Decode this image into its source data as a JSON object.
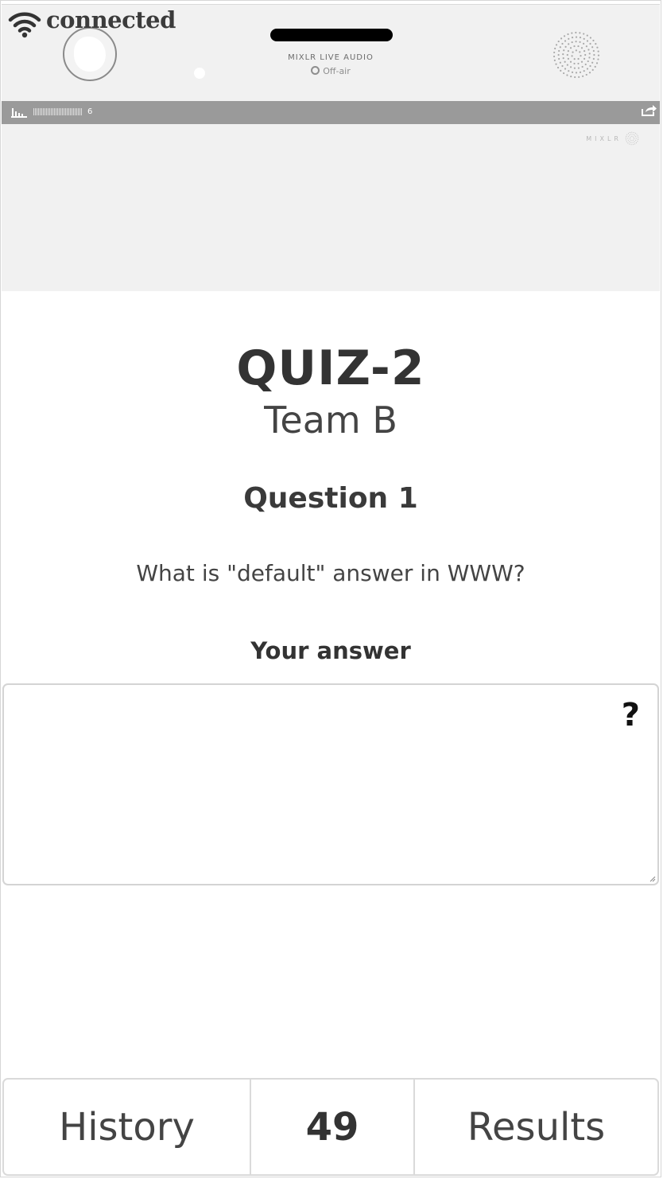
{
  "status": {
    "connection_label": "connected"
  },
  "player": {
    "brand_subtitle": "MIXLR LIVE AUDIO",
    "broadcast_status": "Off-air",
    "listener_count": "6",
    "wordmark": "MIXLR"
  },
  "quiz": {
    "title": "QUIZ-2",
    "team": "Team B",
    "question_heading": "Question 1",
    "question_text": "What is \"default\" answer in WWW?",
    "answer_label": "Your answer",
    "answer_value": "",
    "help_symbol": "?"
  },
  "bottom_nav": {
    "history_label": "History",
    "counter": "49",
    "results_label": "Results"
  },
  "colors": {
    "page_background": "#ffffff",
    "player_background": "#f1f1f1",
    "player_bar": "#9a9a9a",
    "text": "#333333",
    "border": "#d4d4d4"
  },
  "icons": [
    "wifi-icon",
    "play-dot-icon",
    "stats-icon",
    "share-icon",
    "mixlr-logo-icon",
    "help-icon",
    "resize-grip-icon"
  ]
}
